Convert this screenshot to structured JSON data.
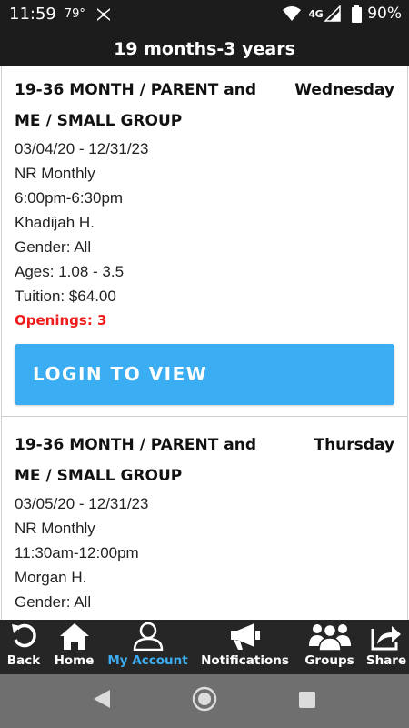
{
  "status_bar": {
    "time": "11:59",
    "temperature": "79°",
    "network": "4G",
    "battery_pct": "90%",
    "icons": [
      "app-icon",
      "wifi-icon",
      "signal-icon",
      "battery-icon"
    ]
  },
  "header": {
    "title": "19 months-3 years"
  },
  "classes": [
    {
      "title": "19-36 MONTH / PARENT and ME / SMALL GROUP",
      "day": "Wednesday",
      "dates": "03/04/20 - 12/31/23",
      "billing": "NR Monthly",
      "time": "6:00pm-6:30pm",
      "instructor": "Khadijah H.",
      "gender": "Gender: All",
      "ages": "Ages: 1.08 - 3.5",
      "tuition": "Tuition: $64.00",
      "openings": "Openings: 3",
      "button_label": "LOGIN TO VIEW"
    },
    {
      "title": "19-36 MONTH / PARENT and ME / SMALL GROUP",
      "day": "Thursday",
      "dates": "03/05/20 - 12/31/23",
      "billing": "NR Monthly",
      "time": "11:30am-12:00pm",
      "instructor": "Morgan H.",
      "gender": "Gender: All"
    }
  ],
  "bottom_nav": {
    "items": [
      {
        "label": "Back",
        "icon": "back-icon",
        "active": false
      },
      {
        "label": "Home",
        "icon": "home-icon",
        "active": false
      },
      {
        "label": "My Account",
        "icon": "account-icon",
        "active": true
      },
      {
        "label": "Notifications",
        "icon": "megaphone-icon",
        "active": false
      },
      {
        "label": "Groups",
        "icon": "groups-icon",
        "active": false
      },
      {
        "label": "Share",
        "icon": "share-icon",
        "active": false
      }
    ],
    "active_color": "#3badf2"
  },
  "colors": {
    "header_bg": "#1c1c1c",
    "button_bg": "#3badf2",
    "openings_text": "#ee1c1c",
    "nav_bg": "#262626",
    "system_nav_bg": "#6f6f6f"
  }
}
